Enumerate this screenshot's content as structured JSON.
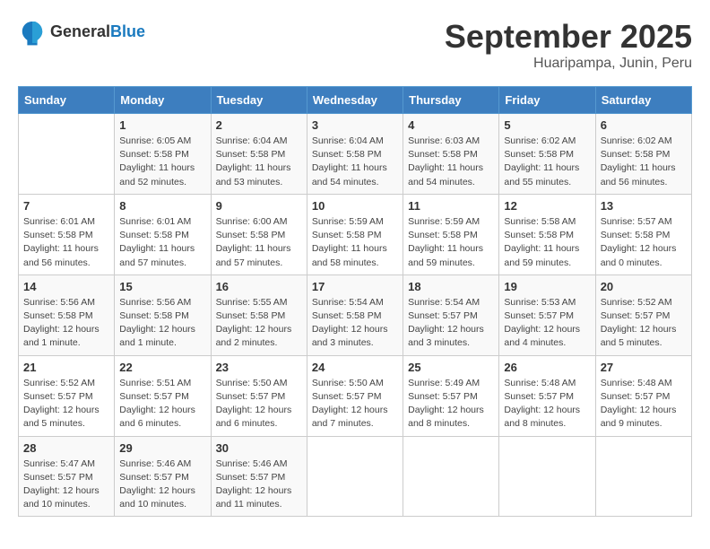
{
  "header": {
    "logo_general": "General",
    "logo_blue": "Blue",
    "month_title": "September 2025",
    "subtitle": "Huaripampa, Junin, Peru"
  },
  "days_of_week": [
    "Sunday",
    "Monday",
    "Tuesday",
    "Wednesday",
    "Thursday",
    "Friday",
    "Saturday"
  ],
  "weeks": [
    [
      {
        "day": "",
        "info": ""
      },
      {
        "day": "1",
        "info": "Sunrise: 6:05 AM\nSunset: 5:58 PM\nDaylight: 11 hours\nand 52 minutes."
      },
      {
        "day": "2",
        "info": "Sunrise: 6:04 AM\nSunset: 5:58 PM\nDaylight: 11 hours\nand 53 minutes."
      },
      {
        "day": "3",
        "info": "Sunrise: 6:04 AM\nSunset: 5:58 PM\nDaylight: 11 hours\nand 54 minutes."
      },
      {
        "day": "4",
        "info": "Sunrise: 6:03 AM\nSunset: 5:58 PM\nDaylight: 11 hours\nand 54 minutes."
      },
      {
        "day": "5",
        "info": "Sunrise: 6:02 AM\nSunset: 5:58 PM\nDaylight: 11 hours\nand 55 minutes."
      },
      {
        "day": "6",
        "info": "Sunrise: 6:02 AM\nSunset: 5:58 PM\nDaylight: 11 hours\nand 56 minutes."
      }
    ],
    [
      {
        "day": "7",
        "info": "Sunrise: 6:01 AM\nSunset: 5:58 PM\nDaylight: 11 hours\nand 56 minutes."
      },
      {
        "day": "8",
        "info": "Sunrise: 6:01 AM\nSunset: 5:58 PM\nDaylight: 11 hours\nand 57 minutes."
      },
      {
        "day": "9",
        "info": "Sunrise: 6:00 AM\nSunset: 5:58 PM\nDaylight: 11 hours\nand 57 minutes."
      },
      {
        "day": "10",
        "info": "Sunrise: 5:59 AM\nSunset: 5:58 PM\nDaylight: 11 hours\nand 58 minutes."
      },
      {
        "day": "11",
        "info": "Sunrise: 5:59 AM\nSunset: 5:58 PM\nDaylight: 11 hours\nand 59 minutes."
      },
      {
        "day": "12",
        "info": "Sunrise: 5:58 AM\nSunset: 5:58 PM\nDaylight: 11 hours\nand 59 minutes."
      },
      {
        "day": "13",
        "info": "Sunrise: 5:57 AM\nSunset: 5:58 PM\nDaylight: 12 hours\nand 0 minutes."
      }
    ],
    [
      {
        "day": "14",
        "info": "Sunrise: 5:56 AM\nSunset: 5:58 PM\nDaylight: 12 hours\nand 1 minute."
      },
      {
        "day": "15",
        "info": "Sunrise: 5:56 AM\nSunset: 5:58 PM\nDaylight: 12 hours\nand 1 minute."
      },
      {
        "day": "16",
        "info": "Sunrise: 5:55 AM\nSunset: 5:58 PM\nDaylight: 12 hours\nand 2 minutes."
      },
      {
        "day": "17",
        "info": "Sunrise: 5:54 AM\nSunset: 5:58 PM\nDaylight: 12 hours\nand 3 minutes."
      },
      {
        "day": "18",
        "info": "Sunrise: 5:54 AM\nSunset: 5:57 PM\nDaylight: 12 hours\nand 3 minutes."
      },
      {
        "day": "19",
        "info": "Sunrise: 5:53 AM\nSunset: 5:57 PM\nDaylight: 12 hours\nand 4 minutes."
      },
      {
        "day": "20",
        "info": "Sunrise: 5:52 AM\nSunset: 5:57 PM\nDaylight: 12 hours\nand 5 minutes."
      }
    ],
    [
      {
        "day": "21",
        "info": "Sunrise: 5:52 AM\nSunset: 5:57 PM\nDaylight: 12 hours\nand 5 minutes."
      },
      {
        "day": "22",
        "info": "Sunrise: 5:51 AM\nSunset: 5:57 PM\nDaylight: 12 hours\nand 6 minutes."
      },
      {
        "day": "23",
        "info": "Sunrise: 5:50 AM\nSunset: 5:57 PM\nDaylight: 12 hours\nand 6 minutes."
      },
      {
        "day": "24",
        "info": "Sunrise: 5:50 AM\nSunset: 5:57 PM\nDaylight: 12 hours\nand 7 minutes."
      },
      {
        "day": "25",
        "info": "Sunrise: 5:49 AM\nSunset: 5:57 PM\nDaylight: 12 hours\nand 8 minutes."
      },
      {
        "day": "26",
        "info": "Sunrise: 5:48 AM\nSunset: 5:57 PM\nDaylight: 12 hours\nand 8 minutes."
      },
      {
        "day": "27",
        "info": "Sunrise: 5:48 AM\nSunset: 5:57 PM\nDaylight: 12 hours\nand 9 minutes."
      }
    ],
    [
      {
        "day": "28",
        "info": "Sunrise: 5:47 AM\nSunset: 5:57 PM\nDaylight: 12 hours\nand 10 minutes."
      },
      {
        "day": "29",
        "info": "Sunrise: 5:46 AM\nSunset: 5:57 PM\nDaylight: 12 hours\nand 10 minutes."
      },
      {
        "day": "30",
        "info": "Sunrise: 5:46 AM\nSunset: 5:57 PM\nDaylight: 12 hours\nand 11 minutes."
      },
      {
        "day": "",
        "info": ""
      },
      {
        "day": "",
        "info": ""
      },
      {
        "day": "",
        "info": ""
      },
      {
        "day": "",
        "info": ""
      }
    ]
  ]
}
